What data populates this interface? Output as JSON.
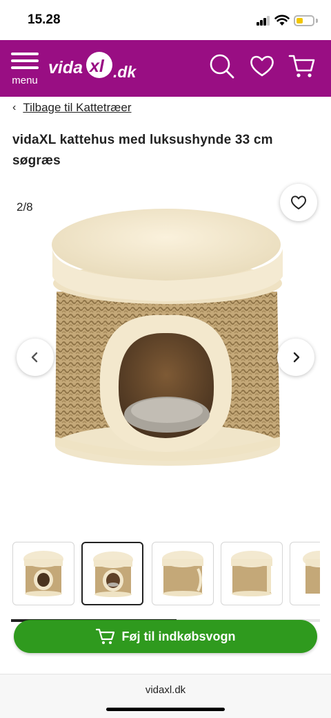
{
  "status": {
    "time": "15.28",
    "battery_color": "#f2c600"
  },
  "header": {
    "background": "#990e83",
    "menu_label": "menu",
    "logo_text_left": "vida",
    "logo_text_mid": "xl",
    "logo_text_right": ".dk",
    "icons": [
      "menu-icon",
      "search-icon",
      "heart-icon",
      "cart-icon"
    ]
  },
  "breadcrumb": {
    "chevron": "‹",
    "label": "Tilbage til Kattetræer"
  },
  "product": {
    "title": "vidaXL kattehus med luksushynde 33 cm søgræs",
    "image_counter": "2/8",
    "thumbnail_count_visible": 5,
    "active_thumbnail": 2
  },
  "cart_button": {
    "label": "Føj til indkøbsvogn",
    "color": "#2f9a1e"
  },
  "browser": {
    "url": "vidaxl.dk"
  }
}
